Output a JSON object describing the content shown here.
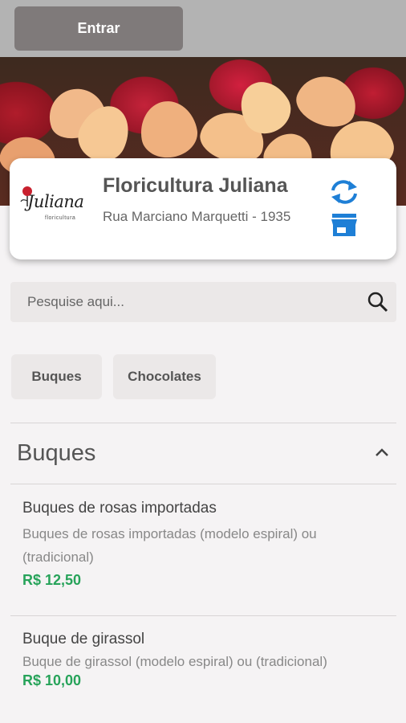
{
  "header": {
    "login_label": "Entrar"
  },
  "store": {
    "name": "Floricultura Juliana",
    "address": "Rua Marciano Marquetti - 1935",
    "logo_text": "Juliana",
    "logo_sub": "floricultura"
  },
  "search": {
    "placeholder": "Pesquise aqui..."
  },
  "categories": [
    "Buques",
    "Chocolates"
  ],
  "section": {
    "title": "Buques",
    "expanded": true
  },
  "products": [
    {
      "name": "Buques de rosas importadas",
      "description": "Buques de rosas importadas (modelo espiral) ou (tradicional)",
      "price": "R$ 12,50"
    },
    {
      "name": "Buque de girassol",
      "description": "Buque de girassol (modelo espiral) ou (tradicional)",
      "price": "R$ 10,00"
    }
  ],
  "colors": {
    "accent": "#1e7fd6",
    "price": "#27a35a",
    "topbar": "#b3b3b3",
    "login_button": "#7f7a7a"
  },
  "icons": [
    "sync-icon",
    "store-icon",
    "search-icon",
    "chevron-up-icon",
    "rose-logo-icon"
  ]
}
